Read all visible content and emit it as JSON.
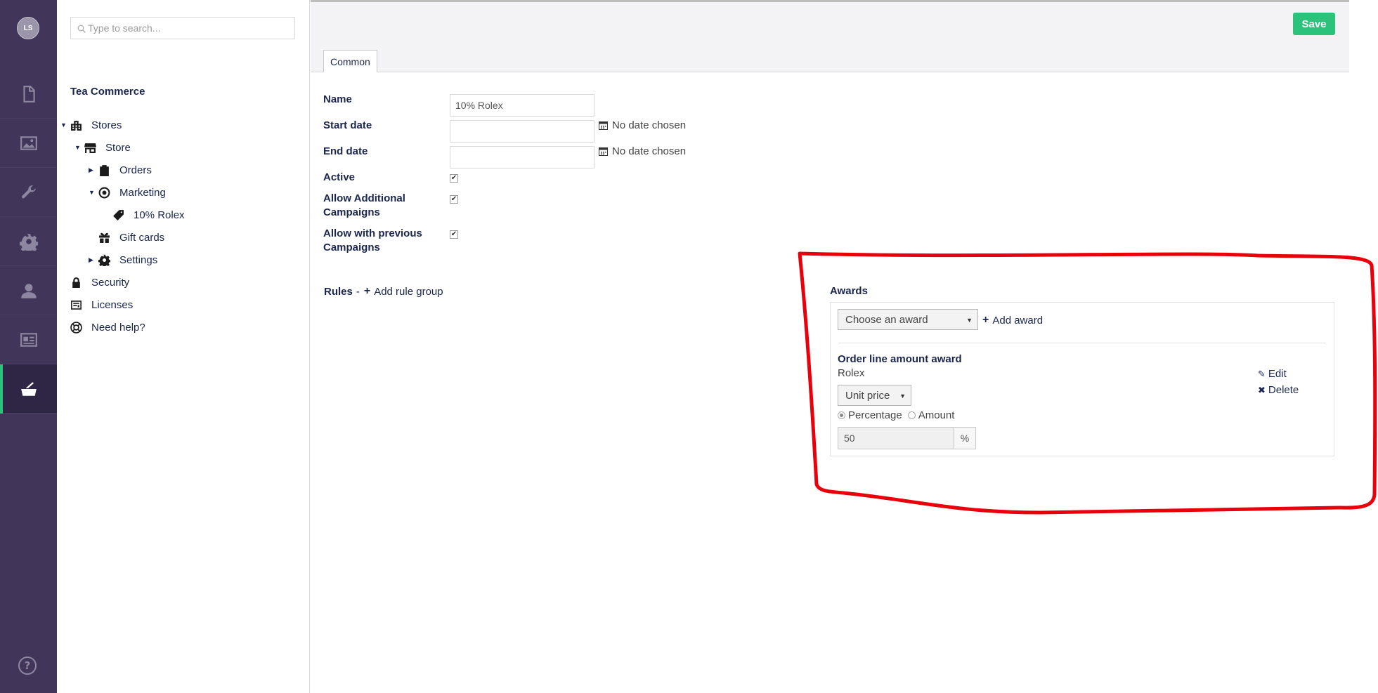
{
  "rail": {
    "avatar_initials": "LS",
    "items": [
      "content-icon",
      "media-icon",
      "settings-wrench-icon",
      "gear-icon",
      "users-icon",
      "members-icon",
      "commerce-icon"
    ]
  },
  "tree": {
    "search_placeholder": "Type to search...",
    "section_title": "Tea Commerce",
    "nodes": {
      "stores": "Stores",
      "store": "Store",
      "orders": "Orders",
      "marketing": "Marketing",
      "campaign": "10% Rolex",
      "gift_cards": "Gift cards",
      "settings": "Settings",
      "security": "Security",
      "licenses": "Licenses",
      "help": "Need help?"
    }
  },
  "toolbar": {
    "save_label": "Save",
    "tab_common": "Common"
  },
  "form": {
    "name_label": "Name",
    "name_value": "10% Rolex",
    "start_date_label": "Start date",
    "end_date_label": "End date",
    "no_date_text": "No date chosen",
    "active_label": "Active",
    "allow_additional_label_1": "Allow Additional",
    "allow_additional_label_2": "Campaigns",
    "allow_previous_label_1": "Allow with previous",
    "allow_previous_label_2": "Campaigns",
    "check_glyph": "✔"
  },
  "rules": {
    "label": "Rules",
    "separator": "-",
    "add_rule_group": "Add rule group"
  },
  "awards": {
    "title": "Awards",
    "choose_placeholder": "Choose an award",
    "add_award": "Add award",
    "award_name": "Order line amount award",
    "award_product": "Rolex",
    "price_type": "Unit price",
    "radio_percentage": "Percentage",
    "radio_amount": "Amount",
    "amount_value": "50",
    "unit": "%",
    "edit": "Edit",
    "delete": "Delete"
  },
  "colors": {
    "rail_bg": "#413659",
    "accent_green": "#2bc37c",
    "annotation_red": "#e8000b"
  }
}
